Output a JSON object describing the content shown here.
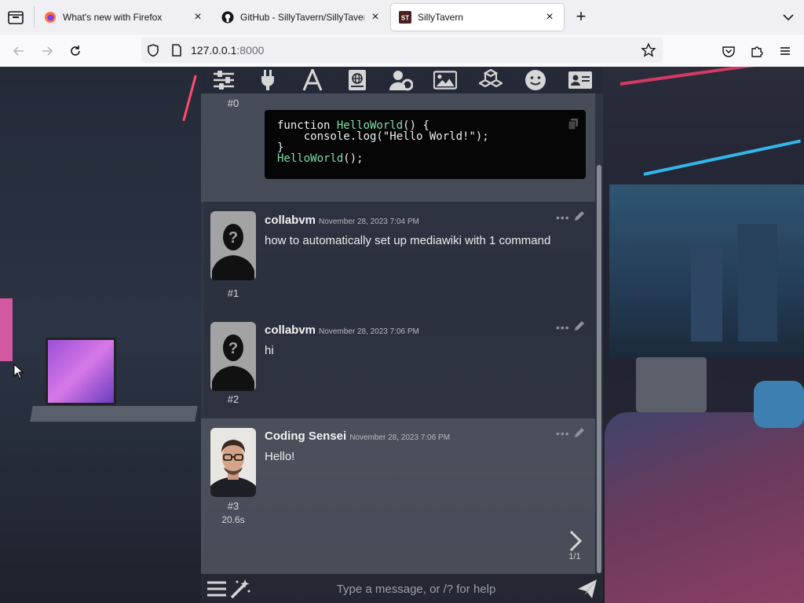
{
  "browser": {
    "tabs": [
      {
        "title": "What's new with Firefox",
        "icon": "firefox-icon"
      },
      {
        "title": "GitHub - SillyTavern/SillyTavern",
        "icon": "github-icon"
      },
      {
        "title": "SillyTavern",
        "icon": "sillytavern-icon",
        "active": true
      }
    ],
    "url": {
      "host": "127.0.0.1",
      "port": ":8000"
    },
    "colors": {
      "tabbar": "#f0f0f4",
      "navbar": "#f9f9fb"
    }
  },
  "toolbar_icons": [
    "sliders-icon",
    "plug-icon",
    "font-icon",
    "world-book-icon",
    "user-settings-icon",
    "image-icon",
    "extensions-icon",
    "smile-icon",
    "character-card-icon"
  ],
  "chat": {
    "first_message": {
      "id": "#0",
      "code_lines": [
        {
          "a": "function ",
          "b": "HelloWorld",
          "c": "() {"
        },
        {
          "a": "    console.log(\"Hello World!\");",
          "b": "",
          "c": ""
        },
        {
          "a": "}",
          "b": "",
          "c": ""
        },
        {
          "a": "",
          "b": "HelloWorld",
          "c": "();"
        }
      ]
    },
    "messages": [
      {
        "id": "#1",
        "name": "collabvm",
        "date": "November 28, 2023 7:04 PM",
        "text": "how to automatically set up mediawiki with 1 command",
        "avatar": "default-user"
      },
      {
        "id": "#2",
        "name": "collabvm",
        "date": "November 28, 2023 7:06 PM",
        "text": "hi",
        "avatar": "default-user"
      },
      {
        "id": "#3",
        "name": "Coding Sensei",
        "date": "November 28, 2023 7:06 PM",
        "text": "Hello!",
        "avatar": "coding-sensei",
        "timer": "20.6s",
        "swipe_counter": "1/1"
      }
    ]
  },
  "input": {
    "placeholder": "Type a message, or /? for help"
  },
  "colors": {
    "code_function": "#7ee0a6",
    "code_bg": "#050505"
  }
}
